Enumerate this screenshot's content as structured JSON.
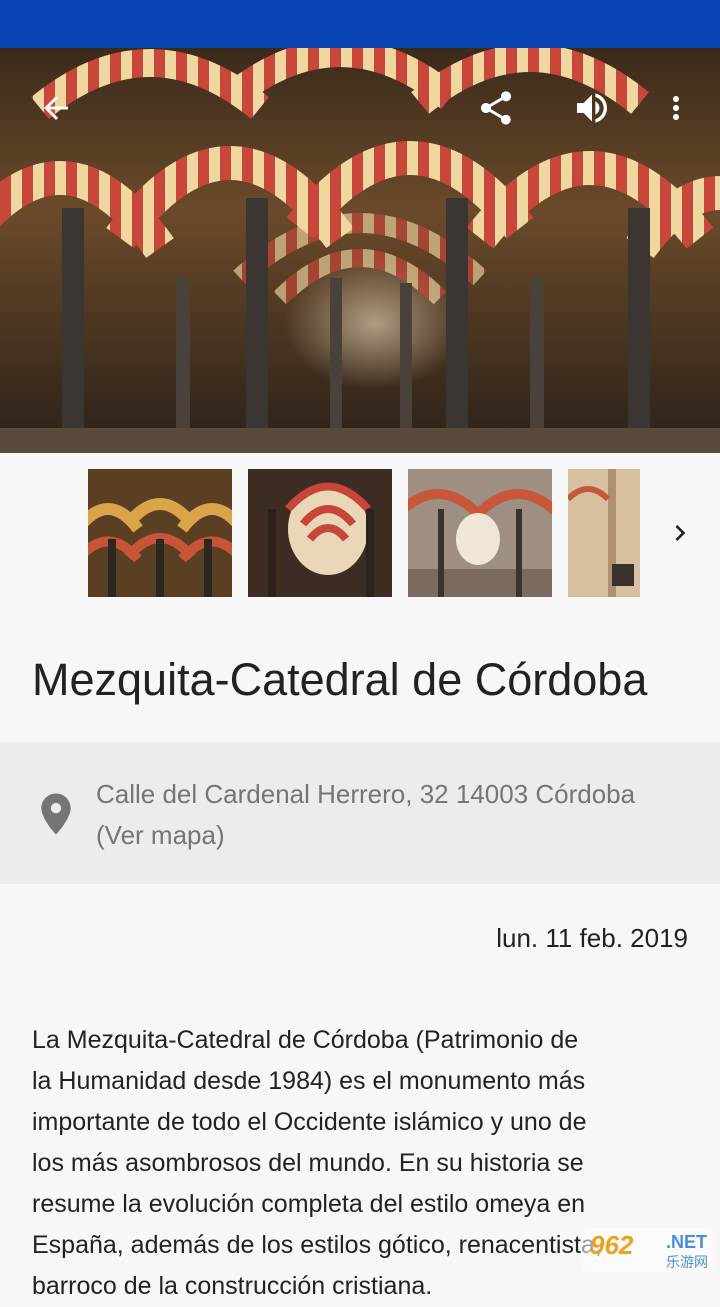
{
  "header": {
    "back_icon": "arrow-back-icon",
    "share_icon": "share-icon",
    "volume_icon": "volume-icon",
    "more_icon": "more-vert-icon",
    "status_bar_color": "#0a44b4"
  },
  "gallery": {
    "next_icon": "chevron-right-icon"
  },
  "place": {
    "title": "Mezquita-Catedral de Córdoba",
    "address_line1": "Calle del Cardenal Herrero, 32 14003 Córdoba",
    "address_line2": "(Ver mapa)",
    "location_icon": "location-pin-icon",
    "date": "lun. 11 feb. 2019",
    "description": "La Mezquita-Catedral de Córdoba (Patrimonio de\nla Humanidad desde 1984) es el monumento más\nimportante de todo el Occidente islámico y uno de\nlos más asombrosos del mundo. En su historia se\nresume la evolución completa del estilo omeya en\nEspaña, además de los estilos gótico, renacentista,\nbarroco de la construcción cristiana."
  },
  "watermark": {
    "brand": "962",
    "suffix": ".NET",
    "sub": "乐游网"
  }
}
